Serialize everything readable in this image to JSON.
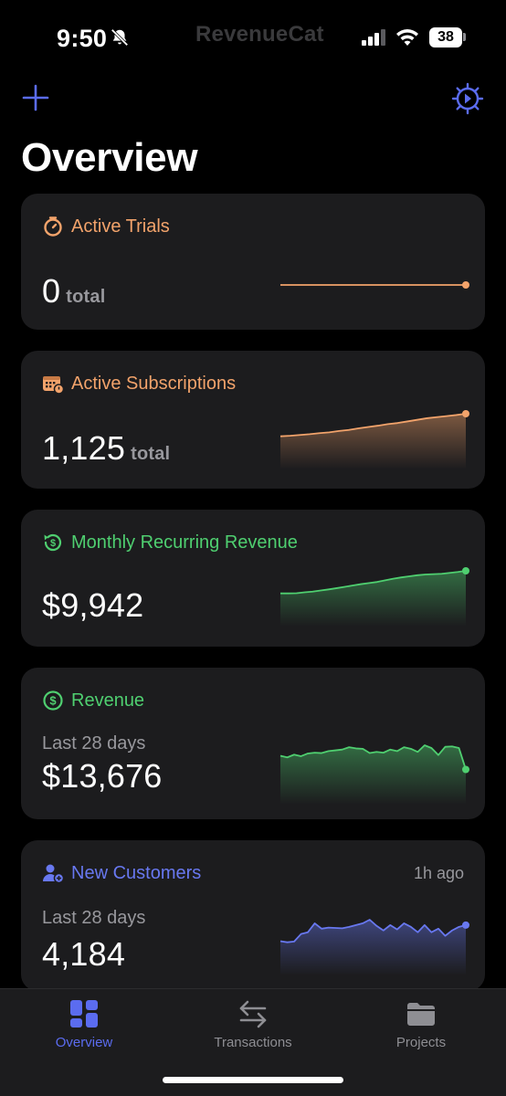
{
  "status_bar": {
    "time": "9:50",
    "brand": "RevenueCat",
    "battery": "38"
  },
  "header": {
    "title": "Overview"
  },
  "cards": [
    {
      "title": "Active Trials",
      "icon": "timer-icon",
      "color": "#f2a36b",
      "value": "0",
      "unit": "total",
      "trend": [
        0,
        0,
        0,
        0,
        0,
        0,
        0,
        0,
        0,
        0,
        0,
        0
      ]
    },
    {
      "title": "Active Subscriptions",
      "icon": "calendar-icon",
      "color": "#f2a36b",
      "value": "1,125",
      "unit": "total",
      "trend": [
        1040,
        1042,
        1045,
        1048,
        1052,
        1055,
        1060,
        1064,
        1070,
        1075,
        1080,
        1086,
        1090,
        1096,
        1102,
        1108,
        1112,
        1116,
        1120,
        1125
      ]
    },
    {
      "title": "Monthly Recurring Revenue",
      "icon": "recurring-revenue-icon",
      "color": "#4fcf70",
      "value": "$9,942",
      "trend": [
        8700,
        8700,
        8710,
        8760,
        8800,
        8860,
        8920,
        8990,
        9060,
        9140,
        9210,
        9270,
        9330,
        9420,
        9510,
        9580,
        9640,
        9700,
        9740,
        9760,
        9780,
        9830,
        9880,
        9942
      ]
    },
    {
      "title": "Revenue",
      "icon": "dollar-circle-icon",
      "color": "#4fcf70",
      "subtitle": "Last 28 days",
      "value": "$13,676",
      "trend": [
        420,
        380,
        450,
        410,
        480,
        500,
        490,
        540,
        560,
        580,
        640,
        610,
        600,
        490,
        520,
        500,
        580,
        540,
        640,
        600,
        520,
        690,
        620,
        440,
        650,
        660,
        620,
        70
      ]
    },
    {
      "title": "New Customers",
      "icon": "add-user-icon",
      "color": "#6878f0",
      "meta": "1h ago",
      "subtitle": "Last 28 days",
      "value": "4,184",
      "trend": [
        145,
        142,
        144,
        165,
        170,
        195,
        180,
        183,
        182,
        181,
        185,
        190,
        195,
        205,
        188,
        175,
        190,
        178,
        195,
        185,
        170,
        190,
        170,
        180,
        160,
        175,
        185,
        190
      ]
    }
  ],
  "tabs": [
    {
      "label": "Overview",
      "icon": "dashboard-icon",
      "active": true
    },
    {
      "label": "Transactions",
      "icon": "arrows-icon",
      "active": false
    },
    {
      "label": "Projects",
      "icon": "folder-icon",
      "active": false
    }
  ],
  "colors": {
    "accent": "#5b6cf0",
    "orange": "#f2a36b",
    "green": "#4fcf70",
    "card_bg": "#1c1c1e"
  }
}
